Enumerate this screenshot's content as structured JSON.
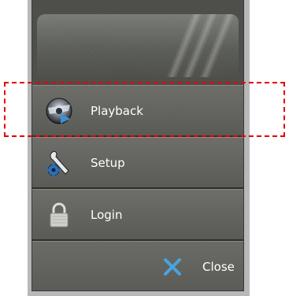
{
  "menu": {
    "items": [
      {
        "label": "Playback",
        "icon": "playback-disc-icon"
      },
      {
        "label": "Setup",
        "icon": "setup-wrench-gear-icon"
      },
      {
        "label": "Login",
        "icon": "login-lock-icon"
      }
    ],
    "close": {
      "label": "Close",
      "icon": "close-x-icon"
    }
  },
  "colors": {
    "panel": "#4e4f4b",
    "close_icon": "#4aa3e0",
    "highlight": "#e60000"
  },
  "highlight": {
    "target": "Playback"
  }
}
